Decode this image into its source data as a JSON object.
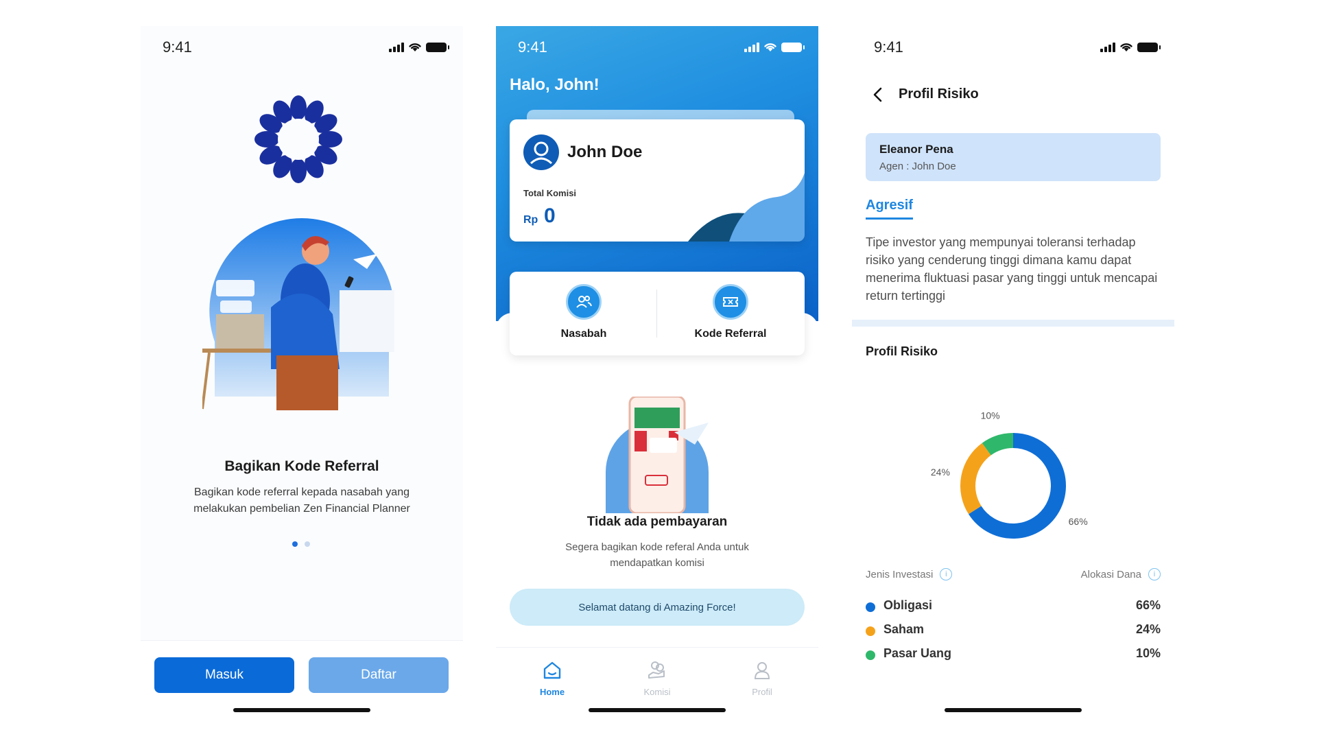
{
  "colors": {
    "primary": "#0a6ad8",
    "secondary": "#6aa8ea",
    "accent": "#1e86e0",
    "obligasi": "#0f6ed6",
    "saham": "#f5a21b",
    "pasar_uang": "#2fb86b"
  },
  "screen1": {
    "time": "9:41",
    "title": "Bagikan Kode Referral",
    "description": "Bagikan kode referral kepada nasabah yang melakukan pembelian Zen Financial Planner",
    "btn_masuk": "Masuk",
    "btn_daftar": "Daftar"
  },
  "screen2": {
    "time": "9:41",
    "greeting": "Halo, John!",
    "card": {
      "name": "John Doe",
      "label": "Total Komisi",
      "currency": "Rp",
      "amount": "0"
    },
    "menu": [
      {
        "label": "Nasabah",
        "icon": "users-icon"
      },
      {
        "label": "Kode Referral",
        "icon": "ticket-icon"
      }
    ],
    "empty_title": "Tidak ada pembayaran",
    "empty_desc": "Segera bagikan kode referal Anda untuk mendapatkan komisi",
    "welcome": "Selamat datang di Amazing Force!",
    "tabs": [
      {
        "label": "Home",
        "icon": "home-icon",
        "active": true
      },
      {
        "label": "Komisi",
        "icon": "commission-icon",
        "active": false
      },
      {
        "label": "Profil",
        "icon": "profile-icon",
        "active": false
      }
    ]
  },
  "screen3": {
    "time": "9:41",
    "title": "Profil Risiko",
    "client_name": "Eleanor Pena",
    "agent": "Agen : John Doe",
    "profile_type": "Agresif",
    "profile_desc": "Tipe investor yang mempunyai toleransi terhadap risiko yang cenderung tinggi dimana kamu dapat menerima fluktuasi pasar yang tinggi untuk mencapai return tertinggi",
    "section_title": "Profil Risiko",
    "legend_col1": "Jenis Investasi",
    "legend_col2": "Alokasi Dana",
    "legend": [
      {
        "name": "Obligasi",
        "pct": "66%"
      },
      {
        "name": "Saham",
        "pct": "24%"
      },
      {
        "name": "Pasar Uang",
        "pct": "10%"
      }
    ]
  },
  "chart_data": {
    "type": "pie",
    "categories": [
      "Obligasi",
      "Saham",
      "Pasar Uang"
    ],
    "values": [
      66,
      24,
      10
    ],
    "labels": [
      "66%",
      "24%",
      "10%"
    ],
    "title": "",
    "colors": [
      "#0f6ed6",
      "#f5a21b",
      "#2fb86b"
    ]
  }
}
